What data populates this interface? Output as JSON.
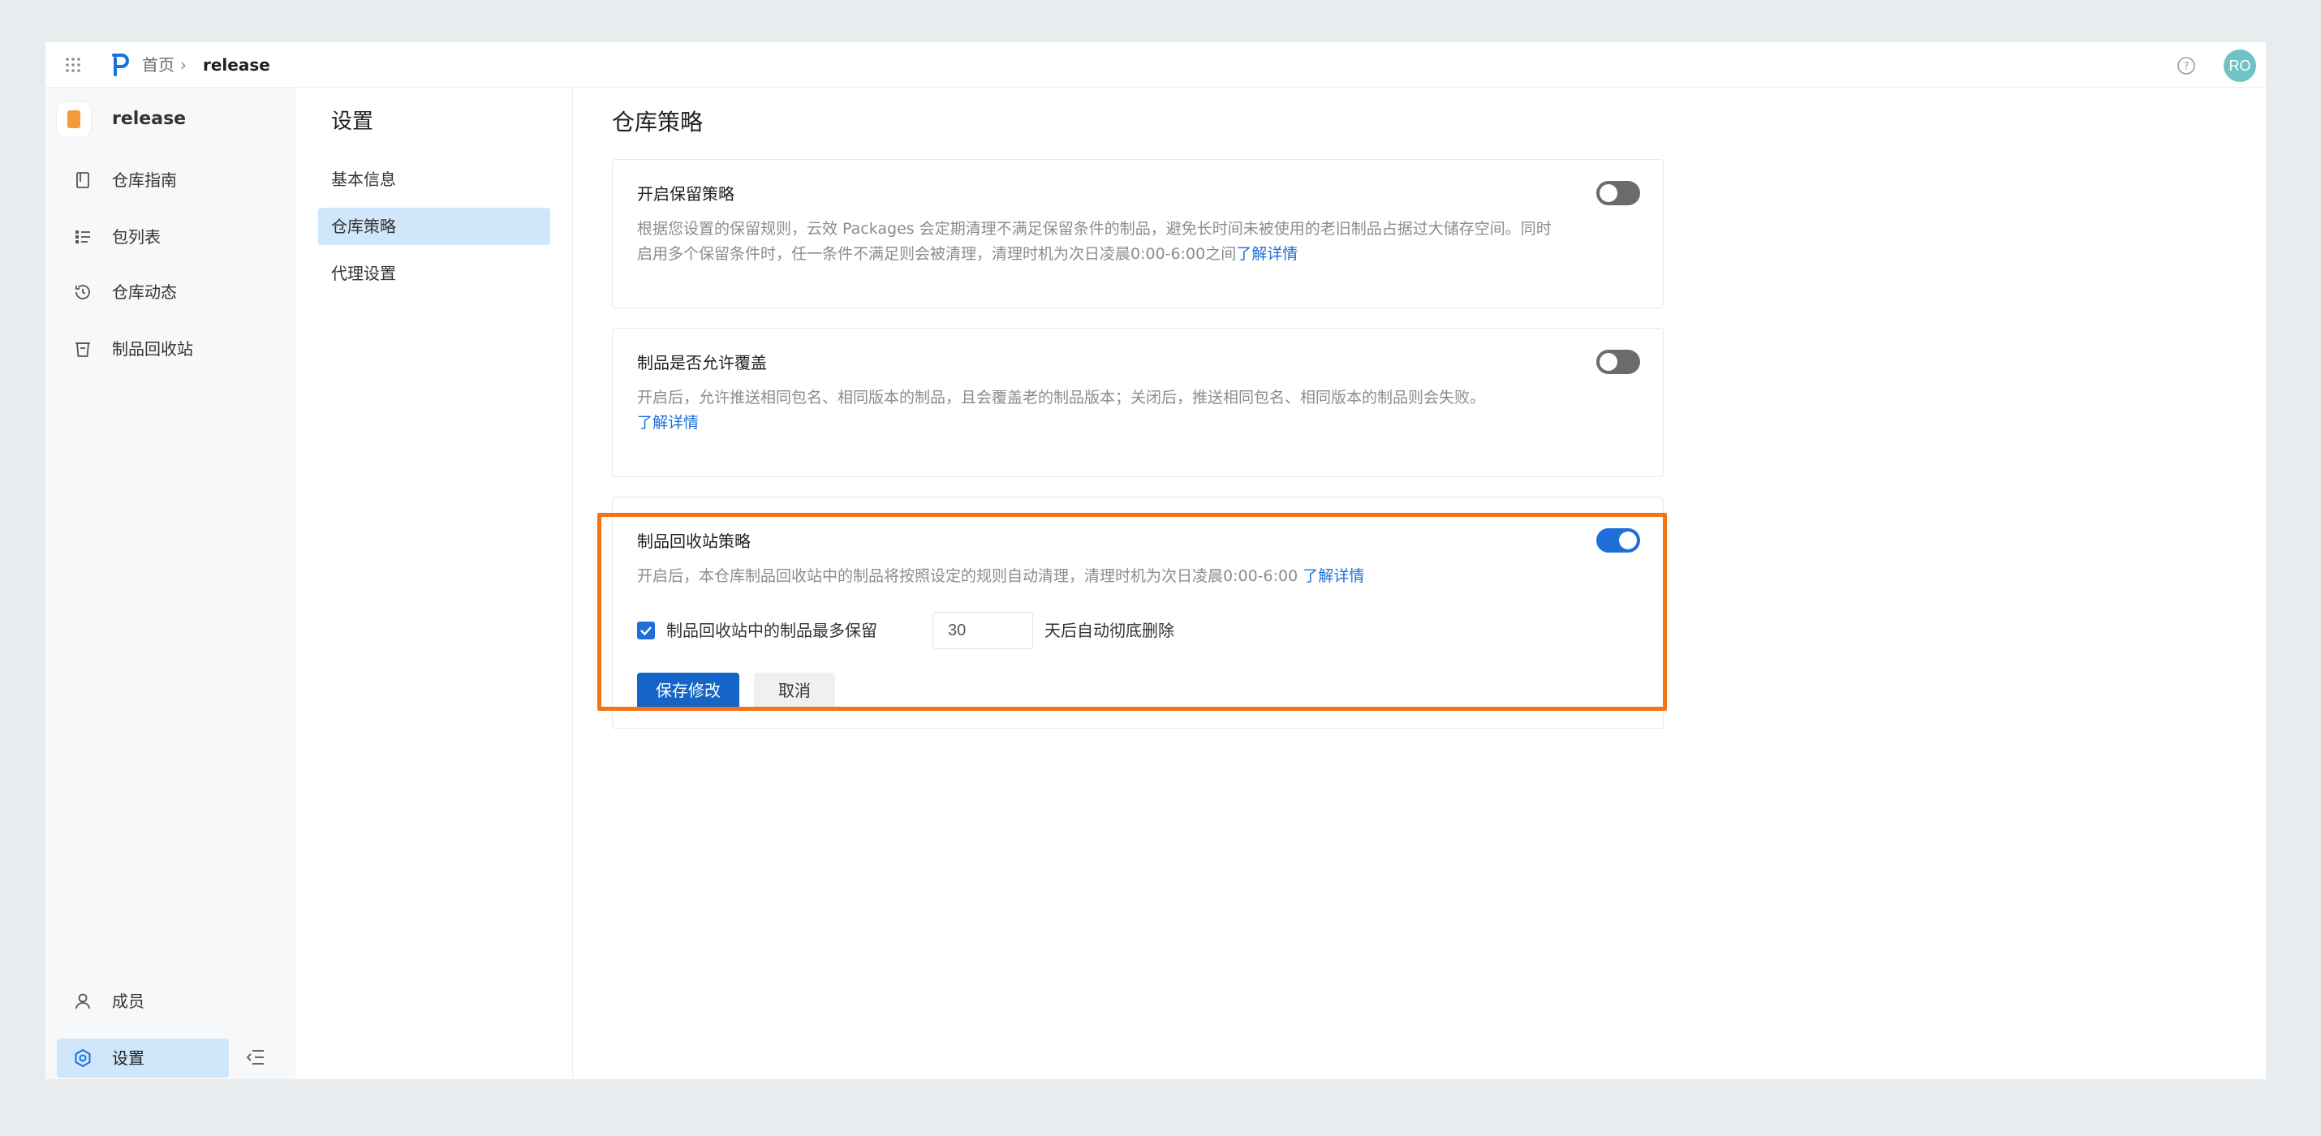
{
  "topbar": {
    "breadcrumb_home": "首页",
    "breadcrumb_separator": "›",
    "breadcrumb_current": "release",
    "avatar_initials": "RO",
    "icons": [
      "grid-apps-icon",
      "logo-icon",
      "help-icon"
    ]
  },
  "sidebar": {
    "repo_name": "release",
    "items": [
      {
        "label": "仓库指南",
        "icon": "book-icon"
      },
      {
        "label": "包列表",
        "icon": "list-icon"
      },
      {
        "label": "仓库动态",
        "icon": "history-icon"
      },
      {
        "label": "制品回收站",
        "icon": "trash-icon"
      }
    ],
    "bottom_items": [
      {
        "label": "成员",
        "icon": "user-icon"
      },
      {
        "label": "设置",
        "icon": "settings-icon",
        "active": true
      }
    ]
  },
  "settings_nav": {
    "title": "设置",
    "items": [
      {
        "label": "基本信息"
      },
      {
        "label": "仓库策略",
        "active": true
      },
      {
        "label": "代理设置"
      }
    ]
  },
  "main": {
    "title": "仓库策略",
    "cards": [
      {
        "title": "开启保留策略",
        "desc_line1": "根据您设置的保留规则，云效 Packages 会定期清理不满足保留条件的制品，避免长时间未被使用的老旧制品占据过大储存空间。同时",
        "desc_line2": "启用多个保留条件时，任一条件不满足则会被清理，清理时机为次日凌晨0:00-6:00之间",
        "link": "了解详情",
        "enabled": false
      },
      {
        "title": "制品是否允许覆盖",
        "desc_line1": "开启后，允许推送相同包名、相同版本的制品，且会覆盖老的制品版本；关闭后，推送相同包名、相同版本的制品则会失败。",
        "link": "了解详情",
        "enabled": false
      },
      {
        "title": "制品回收站策略",
        "desc_line1": "开启后，本仓库制品回收站中的制品将按照设定的规则自动清理，清理时机为次日凌晨0:00-6:00",
        "link": "了解详情",
        "enabled": true,
        "retention_label_before": "制品回收站中的制品最多保留",
        "retention_days": "30",
        "retention_label_after": "天后自动彻底删除",
        "retention_checked": true,
        "save_label": "保存修改",
        "cancel_label": "取消"
      }
    ]
  },
  "colors": {
    "accent": "#1e6fd9",
    "highlight": "#f57215",
    "active_bg": "#cfe6fb"
  }
}
